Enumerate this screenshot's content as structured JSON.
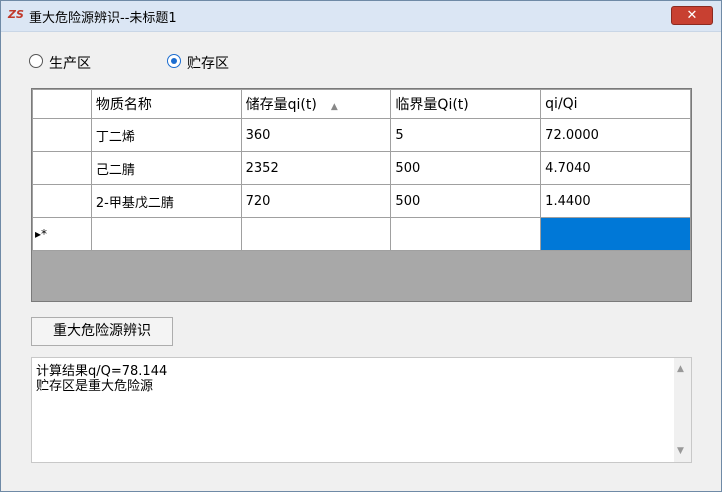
{
  "window": {
    "title": "重大危险源辨识--未标题1",
    "app_icon": "ZS",
    "close_glyph": "✕"
  },
  "area": {
    "option_production": "生产区",
    "option_storage": "贮存区",
    "selected": "贮存区"
  },
  "table": {
    "headers": [
      "物质名称",
      "储存量qi(t)",
      "临界量Qi(t)",
      "qi/Qi"
    ],
    "sorted_column": "储存量qi(t)",
    "rows": [
      [
        "丁二烯",
        "360",
        "5",
        "72.0000"
      ],
      [
        "己二腈",
        "2352",
        "500",
        "4.7040"
      ],
      [
        "2-甲基戊二腈",
        "720",
        "500",
        "1.4400"
      ]
    ],
    "new_row_marker": "▸*"
  },
  "action": {
    "identify_button": "重大危险源辨识"
  },
  "result": {
    "line1": "计算结果q/Q=78.144",
    "line2": "贮存区是重大危险源"
  },
  "colors": {
    "selection": "#0078d7",
    "close_button": "#c84031",
    "grid_background": "#a8a8a8"
  }
}
